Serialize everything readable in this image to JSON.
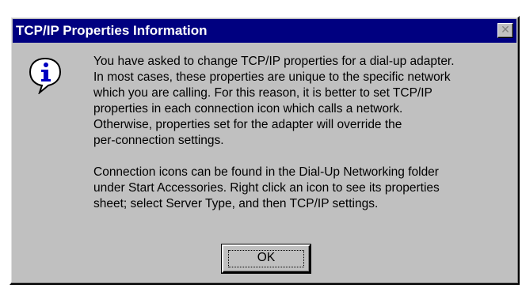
{
  "dialog": {
    "title": "TCP/IP Properties Information",
    "close_glyph": "✕",
    "icon": "information-icon",
    "message": {
      "paragraph1": [
        "You have asked to change TCP/IP properties for a dial-up adapter.",
        "In most cases, these properties are unique to the specific network",
        "which you are calling.  For this reason, it is better to set TCP/IP",
        "properties in each connection icon which calls a network.",
        "Otherwise, properties set for the adapter will override the",
        "per-connection settings."
      ],
      "paragraph2": [
        "Connection icons can be found in the Dial-Up Networking folder",
        "under Start Accessories.  Right click an icon to see its properties",
        "sheet; select Server Type, and then TCP/IP settings."
      ]
    },
    "ok_label": "OK"
  },
  "colors": {
    "titlebar": "#000080",
    "face": "#c0c0c0",
    "title_text": "#ffffff"
  }
}
